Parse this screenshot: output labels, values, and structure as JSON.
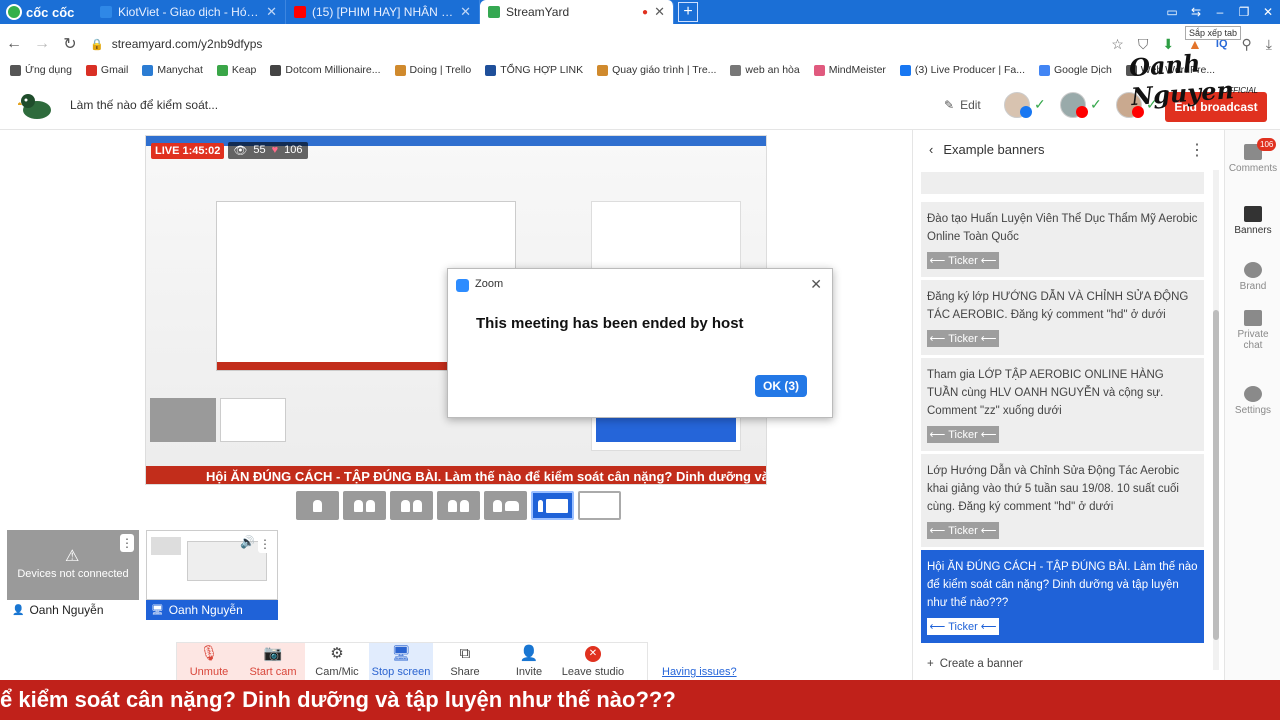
{
  "browser": {
    "brand": "cốc cốc",
    "tabs": [
      {
        "title": "KiotViet - Giao dịch - Hóa đơ",
        "fav": "#2f88e7"
      },
      {
        "title": "(15) [PHIM HAY] NHÂN GIAN",
        "fav": "#ff0000"
      },
      {
        "title": "StreamYard",
        "fav": "#35a852"
      }
    ],
    "tooltip": "Sắp xếp tab",
    "url": "streamyard.com/y2nb9dfyps",
    "bookmarks": [
      {
        "label": "Ứng dụng",
        "color": "#555555"
      },
      {
        "label": "Gmail",
        "color": "#d93025"
      },
      {
        "label": "Manychat",
        "color": "#2b7cd3"
      },
      {
        "label": "Keap",
        "color": "#3aa648"
      },
      {
        "label": "Dotcom Millionaire...",
        "color": "#444444"
      },
      {
        "label": "Doing | Trello",
        "color": "#d08a2d"
      },
      {
        "label": "TỔNG HỢP LINK",
        "color": "#1f4f9a"
      },
      {
        "label": "Quay giáo trình | Tre...",
        "color": "#d08a2d"
      },
      {
        "label": "web an hòa",
        "color": "#777777"
      },
      {
        "label": "MindMeister",
        "color": "#e05a7e"
      },
      {
        "label": "(3) Live Producer | Fa...",
        "color": "#1877f2"
      },
      {
        "label": "Google Dịch",
        "color": "#4285f4"
      },
      {
        "label": "Web WordPre...",
        "color": "#555555"
      }
    ]
  },
  "streamyard": {
    "title": "Làm thế nào để kiểm soát...",
    "edit_label": "Edit",
    "end_broadcast": "End broadcast",
    "signature": "Oanh Nguyen",
    "official": "OFFICIAL"
  },
  "preview": {
    "live_label": "LIVE 1:45:02",
    "viewers": "55",
    "reactions": "106",
    "banner_text": "Hội ĂN ĐÚNG CÁCH - TẬP ĐÚNG BÀI. Làm thế nào để kiểm soát cân nặng? Dinh dưỡng và tập luyện"
  },
  "zoom_dialog": {
    "app": "Zoom",
    "message": "This meeting has been ended by host",
    "ok": "OK (3)"
  },
  "tiles": [
    {
      "name": "Oanh Nguyễn",
      "status": "Devices not connected"
    },
    {
      "name": "Oanh Nguyễn"
    }
  ],
  "controls": [
    {
      "label": "Unmute",
      "icon": "mic-off-icon",
      "state": "red"
    },
    {
      "label": "Start cam",
      "icon": "cam-off-icon",
      "state": "red"
    },
    {
      "label": "Cam/Mic",
      "icon": "gear-icon",
      "state": "normal"
    },
    {
      "label": "Stop screen",
      "icon": "screen-icon",
      "state": "blue"
    },
    {
      "label": "Share",
      "icon": "share-icon",
      "state": "normal"
    },
    {
      "label": "Invite",
      "icon": "invite-icon",
      "state": "normal"
    },
    {
      "label": "Leave studio",
      "icon": "leave-icon",
      "state": "normal"
    }
  ],
  "having_issues": "Having issues?",
  "panel": {
    "title": "Example banners",
    "ticker_label": "Ticker",
    "create": "Create a banner",
    "banners": [
      {
        "text": "Đào tạo Huấn Luyện Viên Thể Dục Thẩm Mỹ Aerobic Online Toàn Quốc",
        "selected": false
      },
      {
        "text": "Đăng ký lớp HƯỚNG DẪN VÀ CHỈNH SỬA ĐỘNG TÁC AEROBIC. Đăng ký comment \"hd\" ở dưới",
        "selected": false
      },
      {
        "text": "Tham gia LỚP TẬP AEROBIC ONLINE HÀNG TUẦN cùng HLV OANH NGUYỄN và cộng sự. Comment \"zz\" xuống dưới",
        "selected": false
      },
      {
        "text": "Lớp Hướng Dẫn và Chỉnh Sửa Động Tác Aerobic khai giảng vào thứ 5 tuần sau 19/08. 10 suất cuối cùng. Đăng ký comment \"hd\" ở dưới",
        "selected": false
      },
      {
        "text": "Hội ĂN ĐÚNG CÁCH - TẬP ĐÚNG BÀI. Làm thế nào để kiểm soát cân nặng? Dinh dưỡng và tập luyện như thế nào???",
        "selected": true
      }
    ]
  },
  "rail": [
    {
      "label": "Comments",
      "count": "106"
    },
    {
      "label": "Banners"
    },
    {
      "label": "Brand"
    },
    {
      "label": "Private chat"
    },
    {
      "label": "Settings"
    }
  ],
  "ticker": "ể kiểm soát cân nặng? Dinh dưỡng và tập luyện như thế nào???"
}
